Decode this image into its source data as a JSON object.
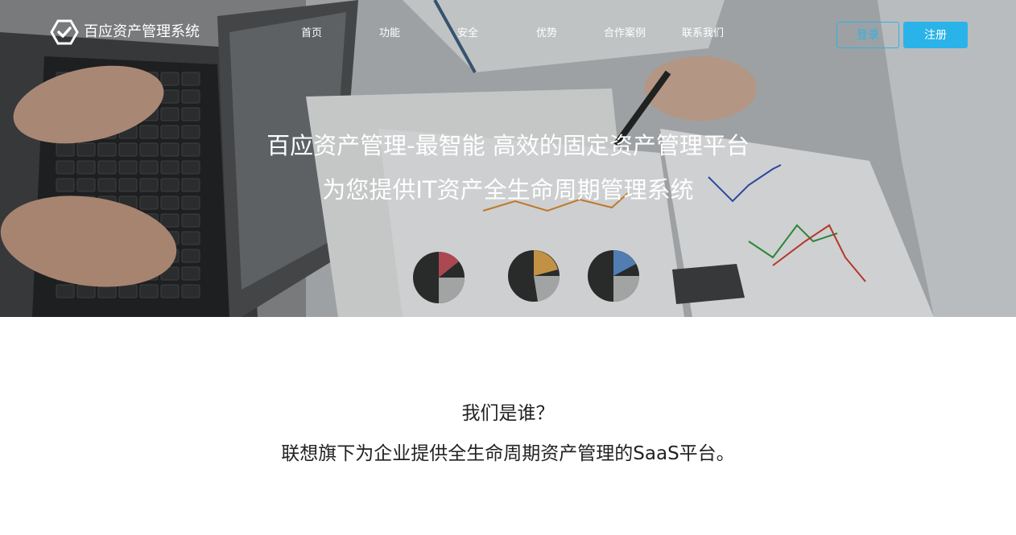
{
  "brand": {
    "name": "百应资产管理系统"
  },
  "nav": {
    "items": [
      {
        "label": "首页"
      },
      {
        "label": "功能"
      },
      {
        "label": "安全"
      },
      {
        "label": "优势"
      },
      {
        "label": "合作案例"
      },
      {
        "label": "联系我们"
      }
    ]
  },
  "auth": {
    "login_label": "登录",
    "register_label": "注册",
    "accent_color": "#2ab3e8"
  },
  "hero": {
    "headline": "百应资产管理-最智能 高效的固定资产管理平台",
    "subheadline": "为您提供IT资产全生命周期管理系统"
  },
  "about": {
    "title": "我们是谁？",
    "description": "联想旗下为企业提供全生命周期资产管理的SaaS平台。"
  }
}
